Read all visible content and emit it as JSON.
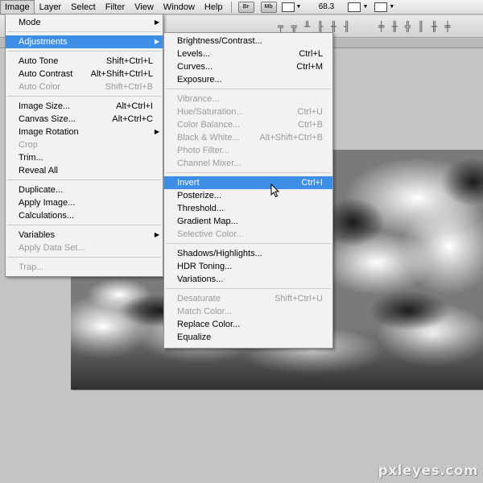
{
  "menubar": {
    "items": [
      "Image",
      "Layer",
      "Select",
      "Filter",
      "View",
      "Window",
      "Help"
    ],
    "badges": [
      "Br",
      "Mb"
    ],
    "zoom": "68.3"
  },
  "image_menu": {
    "rows": [
      {
        "label": "Mode",
        "shortcut": "",
        "submenu": true,
        "disabled": false
      },
      {
        "label": "Adjustments",
        "shortcut": "",
        "submenu": true,
        "disabled": false,
        "highlighted": true
      },
      {
        "label": "Auto Tone",
        "shortcut": "Shift+Ctrl+L"
      },
      {
        "label": "Auto Contrast",
        "shortcut": "Alt+Shift+Ctrl+L"
      },
      {
        "label": "Auto Color",
        "shortcut": "Shift+Ctrl+B",
        "disabled": true
      },
      {
        "label": "Image Size...",
        "shortcut": "Alt+Ctrl+I"
      },
      {
        "label": "Canvas Size...",
        "shortcut": "Alt+Ctrl+C"
      },
      {
        "label": "Image Rotation",
        "shortcut": "",
        "submenu": true
      },
      {
        "label": "Crop",
        "shortcut": "",
        "disabled": true
      },
      {
        "label": "Trim...",
        "shortcut": ""
      },
      {
        "label": "Reveal All",
        "shortcut": ""
      },
      {
        "label": "Duplicate...",
        "shortcut": ""
      },
      {
        "label": "Apply Image...",
        "shortcut": ""
      },
      {
        "label": "Calculations...",
        "shortcut": ""
      },
      {
        "label": "Variables",
        "shortcut": "",
        "submenu": true
      },
      {
        "label": "Apply Data Set...",
        "shortcut": "",
        "disabled": true
      },
      {
        "label": "Trap...",
        "shortcut": "",
        "disabled": true
      }
    ]
  },
  "adjustments_menu": {
    "rows": [
      {
        "label": "Brightness/Contrast...",
        "shortcut": ""
      },
      {
        "label": "Levels...",
        "shortcut": "Ctrl+L"
      },
      {
        "label": "Curves...",
        "shortcut": "Ctrl+M"
      },
      {
        "label": "Exposure...",
        "shortcut": ""
      },
      {
        "label": "Vibrance...",
        "shortcut": "",
        "disabled": true
      },
      {
        "label": "Hue/Saturation...",
        "shortcut": "Ctrl+U",
        "disabled": true
      },
      {
        "label": "Color Balance...",
        "shortcut": "Ctrl+B",
        "disabled": true
      },
      {
        "label": "Black & White...",
        "shortcut": "Alt+Shift+Ctrl+B",
        "disabled": true
      },
      {
        "label": "Photo Filter...",
        "shortcut": "",
        "disabled": true
      },
      {
        "label": "Channel Mixer...",
        "shortcut": "",
        "disabled": true
      },
      {
        "label": "Invert",
        "shortcut": "Ctrl+I",
        "highlighted": true
      },
      {
        "label": "Posterize...",
        "shortcut": ""
      },
      {
        "label": "Threshold...",
        "shortcut": ""
      },
      {
        "label": "Gradient Map...",
        "shortcut": ""
      },
      {
        "label": "Selective Color...",
        "shortcut": "",
        "disabled": true
      },
      {
        "label": "Shadows/Highlights...",
        "shortcut": ""
      },
      {
        "label": "HDR Toning...",
        "shortcut": ""
      },
      {
        "label": "Variations...",
        "shortcut": ""
      },
      {
        "label": "Desaturate",
        "shortcut": "Shift+Ctrl+U",
        "disabled": true
      },
      {
        "label": "Match Color...",
        "shortcut": "",
        "disabled": true
      },
      {
        "label": "Replace Color...",
        "shortcut": ""
      },
      {
        "label": "Equalize",
        "shortcut": ""
      }
    ]
  },
  "watermark": "pxleyes.com",
  "colors": {
    "highlight": "#3d8ee6",
    "menu_bg": "#f2f2f2",
    "disabled_text": "#9b9b9b"
  }
}
